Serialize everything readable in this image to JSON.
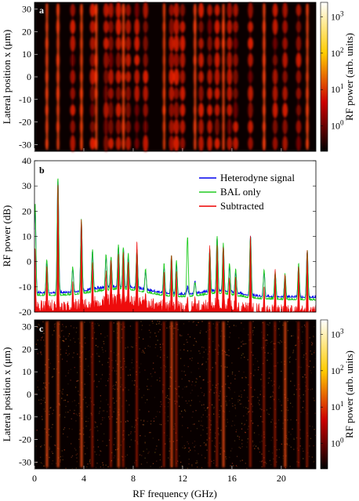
{
  "figure": {
    "xlabel": "RF frequency (GHz)",
    "xticks": [
      0,
      4,
      8,
      12,
      16,
      20
    ],
    "xlim": [
      0,
      22.8
    ]
  },
  "chart_data": [
    {
      "type": "heatmap",
      "panel_label": "a",
      "ylabel": "Lateral position x (μm)",
      "yticks": [
        -30,
        -20,
        -10,
        0,
        10,
        20,
        30
      ],
      "ylim": [
        -33,
        33
      ],
      "colorbar": {
        "label": "RF power (arb. units)",
        "scale": "log",
        "ticks": [
          "10^0",
          "10^1",
          "10^2",
          "10^3"
        ],
        "tick_values": [
          1,
          10,
          100,
          1000
        ],
        "range": [
          0.2,
          2500
        ]
      },
      "line_frequencies_ghz": [
        1.0,
        1.9,
        3.1,
        3.8,
        4.7,
        5.0,
        5.8,
        6.2,
        6.8,
        7.2,
        7.6,
        8.3,
        9.0,
        10.5,
        11.1,
        11.5,
        12.0,
        13.0,
        13.5,
        14.2,
        14.8,
        15.3,
        15.8,
        16.3,
        17.5,
        18.6,
        19.5,
        20.3,
        21.4,
        22.1
      ]
    },
    {
      "type": "line",
      "panel_label": "b",
      "ylabel": "RF power (dB)",
      "yticks": [
        -20,
        -10,
        0,
        10,
        20,
        30,
        40
      ],
      "ylim": [
        -20,
        40
      ],
      "grid": false,
      "legend_position": "top-right",
      "series": [
        {
          "name": "Heterodyne signal",
          "color": "#0000ee"
        },
        {
          "name": "BAL only",
          "color": "#22cc22"
        },
        {
          "name": "Subtracted",
          "color": "#ee0000"
        }
      ],
      "peaks": [
        {
          "f": 0.05,
          "het": 22,
          "bal": 23,
          "sub": 6
        },
        {
          "f": 1.0,
          "het": 0,
          "bal": 1,
          "sub": -2
        },
        {
          "f": 1.9,
          "het": 33,
          "bal": 33.5,
          "sub": 31.5
        },
        {
          "f": 3.1,
          "het": -3,
          "bal": -2,
          "sub": -8
        },
        {
          "f": 3.8,
          "het": 16,
          "bal": 16.5,
          "sub": 17
        },
        {
          "f": 4.7,
          "het": 4,
          "bal": 4.5,
          "sub": 0
        },
        {
          "f": 5.8,
          "het": 2,
          "bal": 3,
          "sub": -4
        },
        {
          "f": 6.2,
          "het": 1,
          "bal": 2,
          "sub": 1
        },
        {
          "f": 6.8,
          "het": 6,
          "bal": 6.5,
          "sub": 3
        },
        {
          "f": 7.2,
          "het": 5,
          "bal": 6,
          "sub": 4
        },
        {
          "f": 7.6,
          "het": 2,
          "bal": 3,
          "sub": 0
        },
        {
          "f": 8.3,
          "het": 4,
          "bal": 4.5,
          "sub": 9
        },
        {
          "f": 9.0,
          "het": -4,
          "bal": -3,
          "sub": -12
        },
        {
          "f": 10.5,
          "het": -2,
          "bal": -1,
          "sub": -4
        },
        {
          "f": 11.1,
          "het": 2,
          "bal": 2.5,
          "sub": 3
        },
        {
          "f": 11.5,
          "het": -1,
          "bal": 0,
          "sub": -4
        },
        {
          "f": 12.4,
          "het": -10,
          "bal": 10,
          "sub": -14
        },
        {
          "f": 13.0,
          "het": -8,
          "bal": -8,
          "sub": -14
        },
        {
          "f": 14.2,
          "het": 4,
          "bal": 5,
          "sub": 7
        },
        {
          "f": 14.8,
          "het": 9,
          "bal": 9.5,
          "sub": 6
        },
        {
          "f": 15.3,
          "het": 6,
          "bal": 7,
          "sub": 6
        },
        {
          "f": 15.8,
          "het": -2,
          "bal": -1,
          "sub": -6
        },
        {
          "f": 16.3,
          "het": -4,
          "bal": -3,
          "sub": -6
        },
        {
          "f": 17.5,
          "het": 10,
          "bal": 10,
          "sub": 10
        },
        {
          "f": 18.6,
          "het": -4,
          "bal": -3,
          "sub": -10
        },
        {
          "f": 19.5,
          "het": -5,
          "bal": -4,
          "sub": -3
        },
        {
          "f": 20.3,
          "het": -6,
          "bal": -5,
          "sub": -5
        },
        {
          "f": 21.4,
          "het": -2,
          "bal": -1,
          "sub": -2
        },
        {
          "f": 22.1,
          "het": 4,
          "bal": 4.5,
          "sub": 5
        }
      ],
      "noise_floor": {
        "het": -13,
        "bal": -14,
        "sub": -20
      }
    },
    {
      "type": "heatmap",
      "panel_label": "c",
      "ylabel": "Lateral position x (μm)",
      "yticks": [
        -30,
        -20,
        -10,
        0,
        10,
        20,
        30
      ],
      "ylim": [
        -33,
        33
      ],
      "colorbar": {
        "label": "RF power (arb. units)",
        "scale": "log",
        "ticks": [
          "10^0",
          "10^1",
          "10^2",
          "10^3"
        ],
        "tick_values": [
          1,
          10,
          100,
          1000
        ],
        "range": [
          0.2,
          2500
        ]
      },
      "line_frequencies_ghz": [
        1.0,
        1.9,
        3.8,
        4.7,
        6.2,
        6.8,
        7.2,
        8.3,
        10.5,
        11.1,
        11.5,
        14.2,
        14.8,
        15.3,
        17.5,
        18.6,
        19.5,
        20.3,
        21.4,
        22.1
      ]
    }
  ]
}
